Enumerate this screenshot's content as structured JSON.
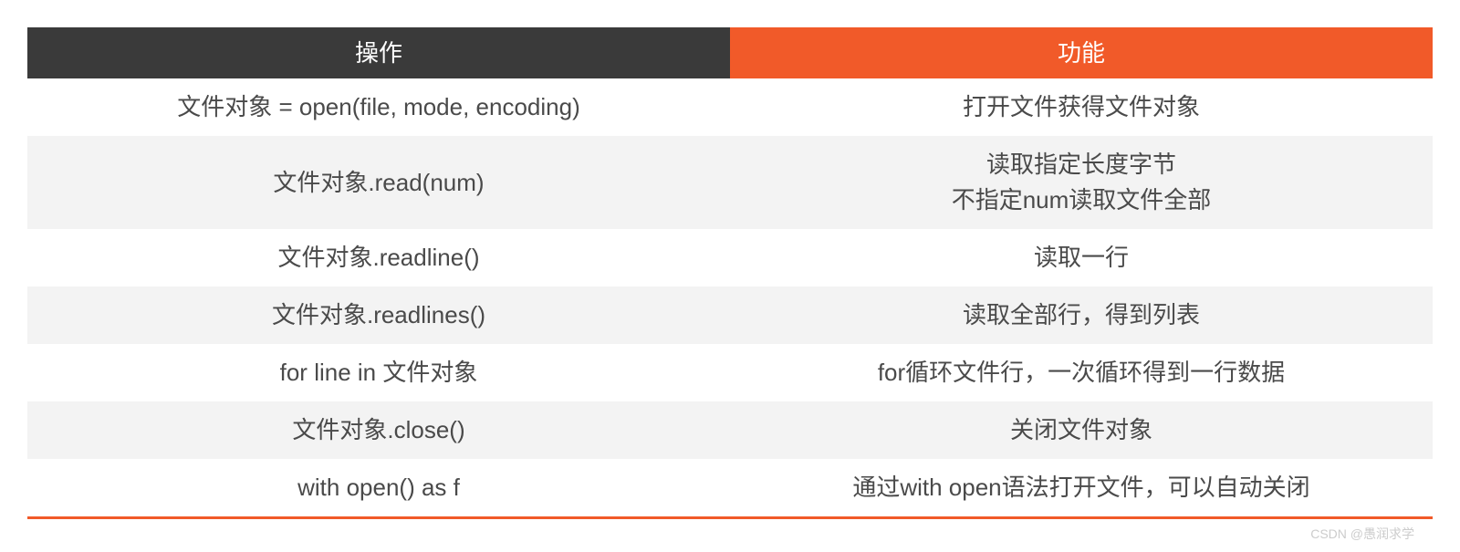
{
  "table": {
    "headers": {
      "left": "操作",
      "right": "功能"
    },
    "rows": [
      {
        "op": "文件对象 = open(file, mode, encoding)",
        "fn": "打开文件获得文件对象"
      },
      {
        "op": "文件对象.read(num)",
        "fn": "读取指定长度字节\n不指定num读取文件全部"
      },
      {
        "op": "文件对象.readline()",
        "fn": "读取一行"
      },
      {
        "op": "文件对象.readlines()",
        "fn": "读取全部行，得到列表"
      },
      {
        "op": "for line in 文件对象",
        "fn": "for循环文件行，一次循环得到一行数据"
      },
      {
        "op": "文件对象.close()",
        "fn": "关闭文件对象"
      },
      {
        "op": "with open() as f",
        "fn": "通过with open语法打开文件，可以自动关闭"
      }
    ]
  },
  "watermark": "CSDN @愚润求学"
}
